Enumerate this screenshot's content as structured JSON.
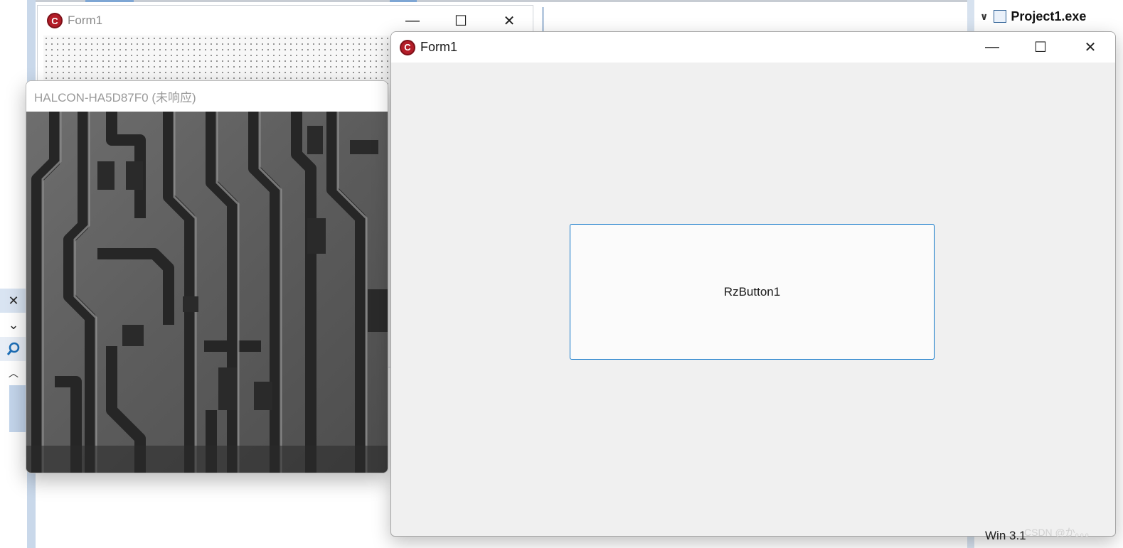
{
  "ide": {
    "left_tools": [
      "close-icon",
      "chevron-down-icon",
      "search-icon",
      "chevron-up-icon"
    ]
  },
  "design_form": {
    "title": "Form1",
    "icon": "app-icon",
    "controls": [
      "minimize-icon",
      "maximize-icon",
      "close-icon"
    ]
  },
  "halcon_window": {
    "title": "HALCON-HA5D87F0 (未响应)",
    "image": "grayscale PCB circuit traces"
  },
  "runtime_form": {
    "title": "Form1",
    "icon": "app-icon",
    "controls": [
      "minimize-icon",
      "maximize-icon",
      "close-icon"
    ],
    "button_label": "RzButton1"
  },
  "project_tree": {
    "item_label": "Project1.exe",
    "icon": "project-exe-icon"
  },
  "footer": {
    "win_label": "Win 3.1",
    "watermark": "CSDN @か。。。"
  },
  "colors": {
    "accent": "#0a74c8",
    "form_bg": "#f0f0f0",
    "rail": "#c9d8ea",
    "icon_red": "#b31d28"
  }
}
